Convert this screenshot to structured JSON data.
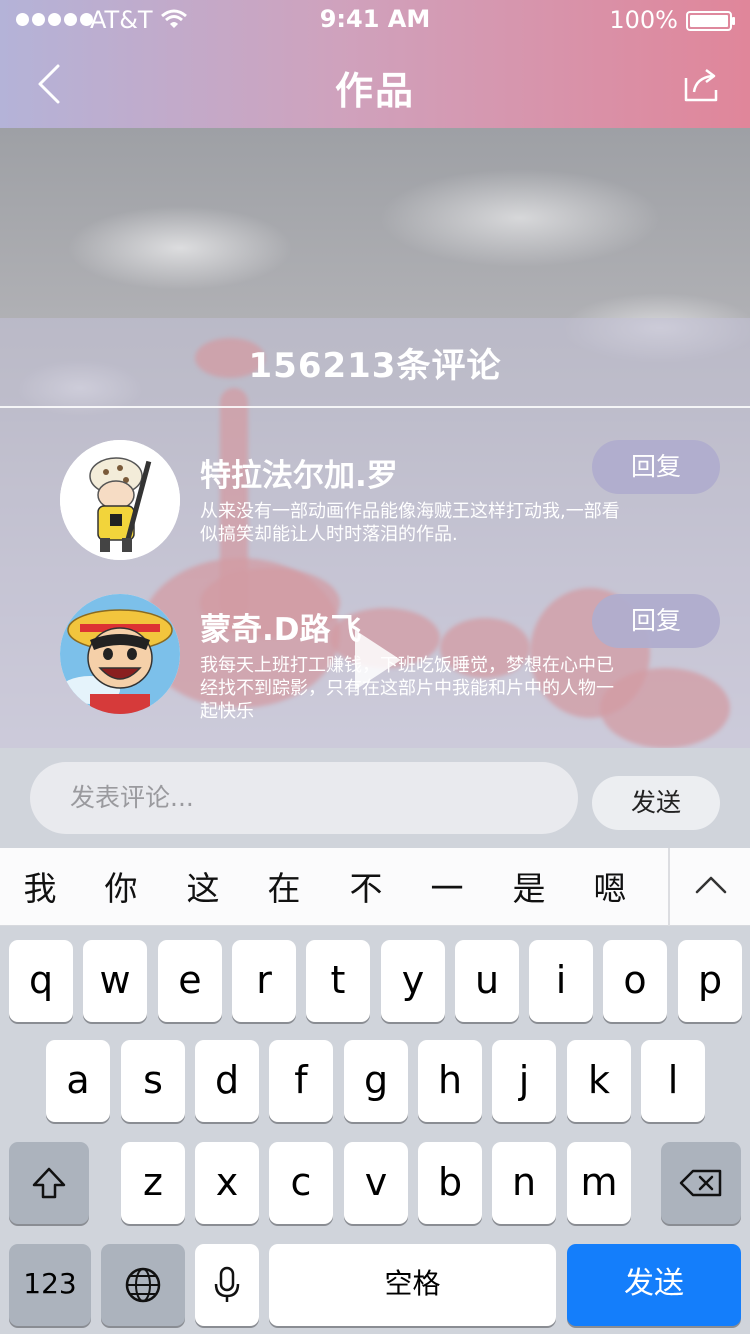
{
  "status_bar": {
    "carrier": "AT&T",
    "time": "9:41 AM",
    "battery": "100%"
  },
  "nav": {
    "title": "作品",
    "back_icon": "chevron-left-icon",
    "share_icon": "share-icon"
  },
  "comments": {
    "count_label": "156213条评论",
    "items": [
      {
        "user": "特拉法尔加.罗",
        "text": "从来没有一部动画作品能像海贼王这样打动我,一部看似搞笑却能让人时时落泪的作品.",
        "reply_label": "回复"
      },
      {
        "user": "蒙奇.D路飞",
        "text": "我每天上班打工赚钱，下班吃饭睡觉，梦想在心中已经找不到踪影，只有在这部片中我能和片中的人物一起快乐",
        "reply_label": "回复"
      }
    ]
  },
  "input": {
    "placeholder": "发表评论...",
    "send_label": "发送"
  },
  "suggestions": [
    "我",
    "你",
    "这",
    "在",
    "不",
    "一",
    "是",
    "嗯"
  ],
  "keyboard": {
    "row1": [
      "q",
      "w",
      "e",
      "r",
      "t",
      "y",
      "u",
      "i",
      "o",
      "p"
    ],
    "row2": [
      "a",
      "s",
      "d",
      "f",
      "g",
      "h",
      "j",
      "k",
      "l"
    ],
    "row3": [
      "z",
      "x",
      "c",
      "v",
      "b",
      "n",
      "m"
    ],
    "numbers_label": "123",
    "space_label": "空格",
    "send_label": "发送"
  },
  "colors": {
    "accent": "#147efb",
    "header_left": "#b4b3d8",
    "header_right": "#e0869a",
    "reply_button": "#b0adcd"
  }
}
